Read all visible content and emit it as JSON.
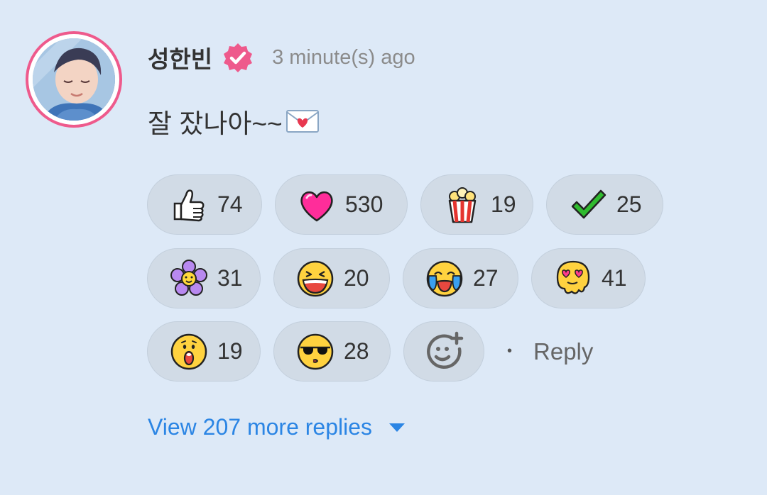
{
  "comment": {
    "author": "성한빈",
    "time": "3 minute(s) ago",
    "message": "잘 잤나아~~",
    "message_emoji": "envelope-heart-icon"
  },
  "reactions": [
    {
      "icon": "thumbs-up-icon",
      "count": "74"
    },
    {
      "icon": "heart-icon",
      "count": "530"
    },
    {
      "icon": "popcorn-icon",
      "count": "19"
    },
    {
      "icon": "checkmark-icon",
      "count": "25"
    },
    {
      "icon": "flower-icon",
      "count": "31"
    },
    {
      "icon": "laughing-face-icon",
      "count": "20"
    },
    {
      "icon": "crying-laughing-face-icon",
      "count": "27"
    },
    {
      "icon": "heart-eyes-melting-face-icon",
      "count": "41"
    },
    {
      "icon": "surprised-face-icon",
      "count": "19"
    },
    {
      "icon": "sunglasses-face-icon",
      "count": "28"
    }
  ],
  "actions": {
    "add_reaction_icon": "add-reaction-icon",
    "reply": "Reply"
  },
  "view_more": {
    "label": "View 207 more replies",
    "icon": "caret-down-icon"
  },
  "colors": {
    "background": "#dde9f7",
    "ring": "#ee5a8c",
    "link": "#2b85e4",
    "pill": "#d1dbe6"
  }
}
